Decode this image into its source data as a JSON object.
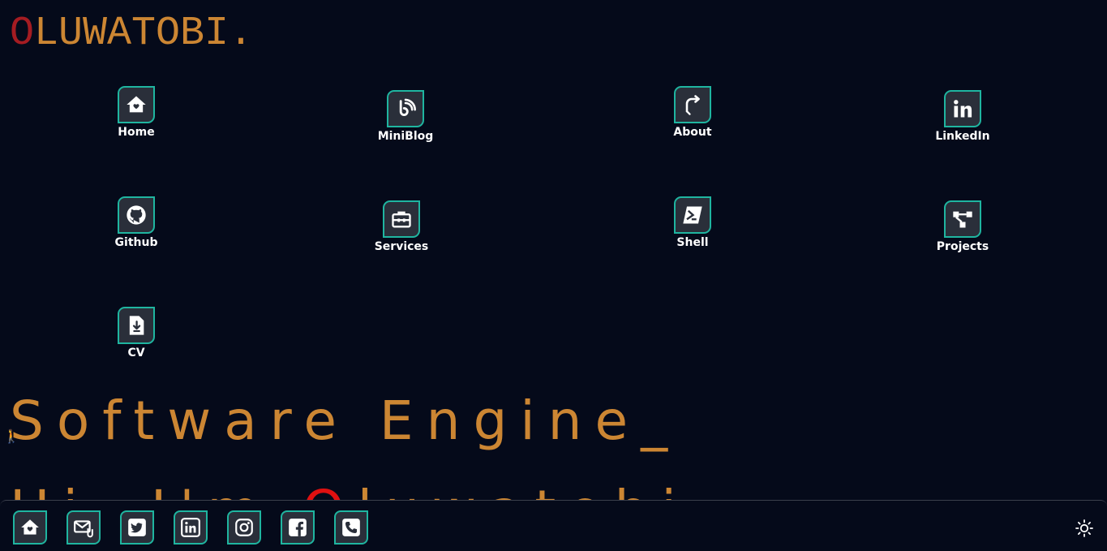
{
  "logo": {
    "first_letter": "O",
    "rest": "LUWATOBI."
  },
  "nav": {
    "items": [
      {
        "label": "Home",
        "icon": "home-heart-icon"
      },
      {
        "label": "MiniBlog",
        "icon": "blog-icon"
      },
      {
        "label": "About",
        "icon": "redirect-arrow-icon"
      },
      {
        "label": "LinkedIn",
        "icon": "linkedin-icon"
      },
      {
        "label": "Github",
        "icon": "github-icon"
      },
      {
        "label": "Services",
        "icon": "toolbox-icon"
      },
      {
        "label": "Shell",
        "icon": "powershell-icon"
      },
      {
        "label": "Projects",
        "icon": "hierarchy-icon"
      },
      {
        "label": "CV",
        "icon": "file-download-icon"
      }
    ]
  },
  "hero": {
    "line1": "Software Engine_",
    "line2_prefix": "Hi, I'm ",
    "line2_accent": "O",
    "line2_rest": "luwatobi"
  },
  "footer": {
    "icons": [
      "home-heart-icon",
      "mail-attachment-icon",
      "twitter-icon",
      "linkedin-icon",
      "instagram-icon",
      "facebook-icon",
      "phone-icon"
    ],
    "theme_toggle_icon": "sun-icon"
  },
  "colors": {
    "background": "#050a1a",
    "accent_orange": "#cc8633",
    "accent_red": "#e01010",
    "border_teal": "#1fb5a0"
  }
}
